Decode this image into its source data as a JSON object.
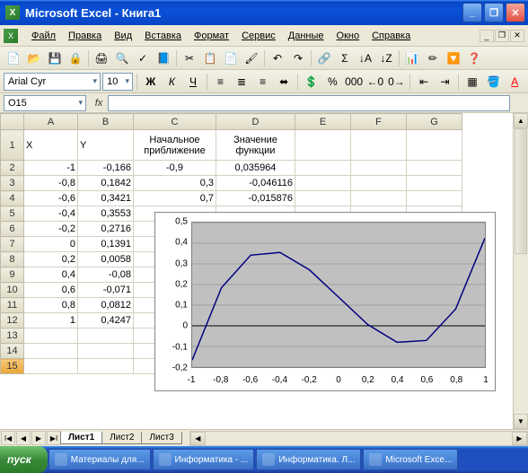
{
  "window": {
    "title": "Microsoft Excel - Книга1",
    "minimize": "_",
    "maximize": "❐",
    "close": "✕"
  },
  "menu": {
    "file": "Файл",
    "edit": "Правка",
    "view": "Вид",
    "insert": "Вставка",
    "format": "Формат",
    "tools": "Сервис",
    "data": "Данные",
    "window": "Окно",
    "help": "Справка"
  },
  "font": {
    "name": "Arial Cyr",
    "size": "10"
  },
  "formula": {
    "namebox": "O15",
    "fx": "fx"
  },
  "columns": {
    "A": "A",
    "B": "B",
    "C": "C",
    "D": "D",
    "E": "E",
    "F": "F",
    "G": "G"
  },
  "colwidths": {
    "A": 60,
    "B": 62,
    "C": 92,
    "D": 88,
    "E": 62,
    "F": 62,
    "G": 62
  },
  "headers": {
    "x": "X",
    "y": "Y",
    "c1": "Начальное",
    "c2": "приближение",
    "d1": "Значение",
    "d2": "функции"
  },
  "table_xy": [
    {
      "r": 2,
      "x": "-1",
      "y": "-0,166"
    },
    {
      "r": 3,
      "x": "-0,8",
      "y": "0,1842"
    },
    {
      "r": 4,
      "x": "-0,6",
      "y": "0,3421"
    },
    {
      "r": 5,
      "x": "-0,4",
      "y": "0,3553"
    },
    {
      "r": 6,
      "x": "-0,2",
      "y": "0,2716"
    },
    {
      "r": 7,
      "x": "0",
      "y": "0,1391"
    },
    {
      "r": 8,
      "x": "0,2",
      "y": "0,0058"
    },
    {
      "r": 9,
      "x": "0,4",
      "y": "-0,08"
    },
    {
      "r": 10,
      "x": "0,6",
      "y": "-0,071"
    },
    {
      "r": 11,
      "x": "0,8",
      "y": "0,0812"
    },
    {
      "r": 12,
      "x": "1",
      "y": "0,4247"
    }
  ],
  "table_cd": [
    {
      "c": "-0,9",
      "d": "0,035964"
    },
    {
      "c": "0,3",
      "d": "-0,046116"
    },
    {
      "c": "0,7",
      "d": "-0,015876"
    }
  ],
  "sheets": {
    "s1": "Лист1",
    "s2": "Лист2",
    "s3": "Лист3"
  },
  "taskbar": {
    "start": "пуск",
    "t1": "Материалы для...",
    "t2": "Информатика - ...",
    "t3": "Информатика. Л...",
    "t4": "Microsoft Exce..."
  },
  "chart_data": {
    "type": "line",
    "x": [
      -1,
      -0.8,
      -0.6,
      -0.4,
      -0.2,
      0,
      0.2,
      0.4,
      0.6,
      0.8,
      1
    ],
    "values": [
      -0.166,
      0.1842,
      0.3421,
      0.3553,
      0.2716,
      0.1391,
      0.0058,
      -0.08,
      -0.071,
      0.0812,
      0.4247
    ],
    "ylim": [
      -0.2,
      0.5
    ],
    "xlim": [
      -1,
      1
    ],
    "yticks": [
      -0.2,
      -0.1,
      0,
      0.1,
      0.2,
      0.3,
      0.4,
      0.5
    ],
    "xticks": [
      -1,
      -0.8,
      -0.6,
      -0.4,
      -0.2,
      0,
      0.2,
      0.4,
      0.6,
      0.8,
      1
    ],
    "xtick_labels": [
      "-1",
      "-0,8",
      "-0,6",
      "-0,4",
      "-0,2",
      "0",
      "0,2",
      "0,4",
      "0,6",
      "0,8",
      "1"
    ],
    "ytick_labels": [
      "-0,2",
      "-0,1",
      "0",
      "0,1",
      "0,2",
      "0,3",
      "0,4",
      "0,5"
    ]
  }
}
